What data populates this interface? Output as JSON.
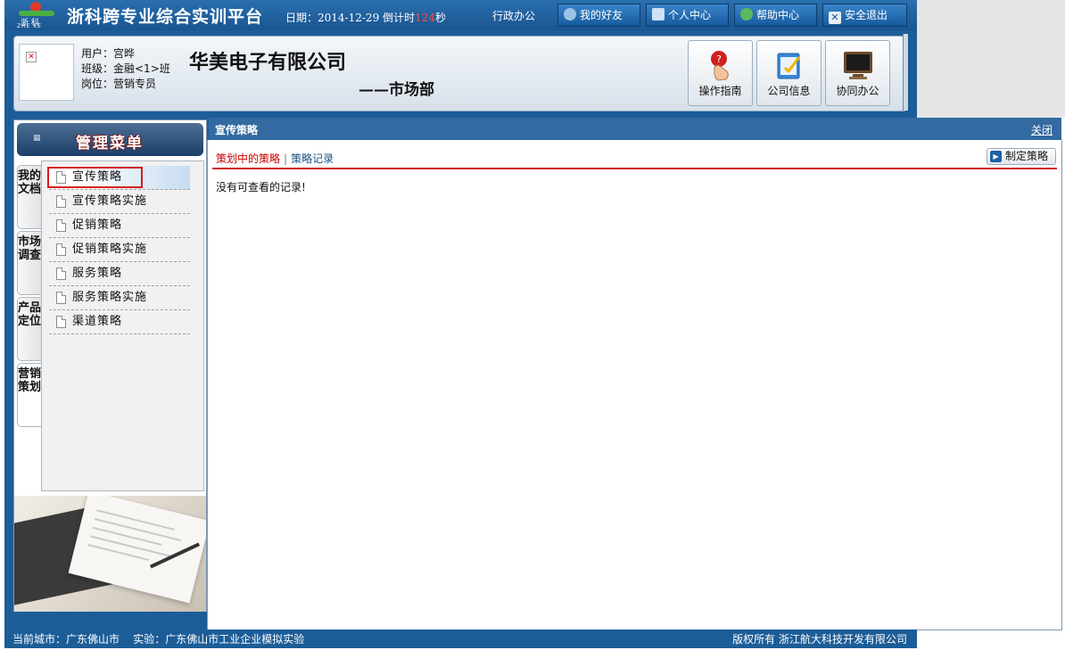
{
  "header": {
    "logo_text": "浙 科",
    "logo_sub": "ZHE KE",
    "app_title": "浙科跨专业综合实训平台",
    "date_label": "日期：",
    "date_value": "2014-12-29",
    "countdown_label": "倒计时",
    "countdown_value": "124",
    "countdown_unit": "秒",
    "admin_link": "行政办公",
    "buttons": [
      {
        "label": "我的好友",
        "icon": "friends-icon"
      },
      {
        "label": "个人中心",
        "icon": "home-icon"
      },
      {
        "label": "帮助中心",
        "icon": "help-icon"
      },
      {
        "label": "安全退出",
        "icon": "close-icon"
      }
    ]
  },
  "user": {
    "name_line": "用户：宫晔",
    "class_line": "班级：金融<1>班",
    "post_line": "岗位：营销专员",
    "company": "华美电子有限公司",
    "dept": "——市场部"
  },
  "quick_links": [
    {
      "label": "操作指南",
      "icon": "guide-hand-icon"
    },
    {
      "label": "公司信息",
      "icon": "notepad-icon"
    },
    {
      "label": "协同办公",
      "icon": "monitor-icon"
    }
  ],
  "sidebar": {
    "menu_title": "管理菜单",
    "vertical_tabs": [
      "我的文档",
      "市场调查",
      "产品定位",
      "营销策划"
    ],
    "active_tab": "营销策划",
    "items": [
      "宣传策略",
      "宣传策略实施",
      "促销策略",
      "促销策略实施",
      "服务策略",
      "服务策略实施",
      "渠道策略"
    ],
    "selected_item": "宣传策略"
  },
  "content": {
    "title": "宣传策略",
    "close_label": "关闭",
    "tab_active": "策划中的策略",
    "tab_other": "策略记录",
    "make_button": "制定策略",
    "empty_message": "没有可查看的记录!"
  },
  "footer": {
    "left": "当前城市：广东佛山市    实验：广东佛山市工业企业模拟实验",
    "right": "版权所有 浙江航大科技开发有限公司"
  },
  "colors": {
    "primary_blue": "#1c5d98",
    "content_header": "#336aa1",
    "accent_red": "#d21818",
    "countdown": "#ff4a3a"
  }
}
